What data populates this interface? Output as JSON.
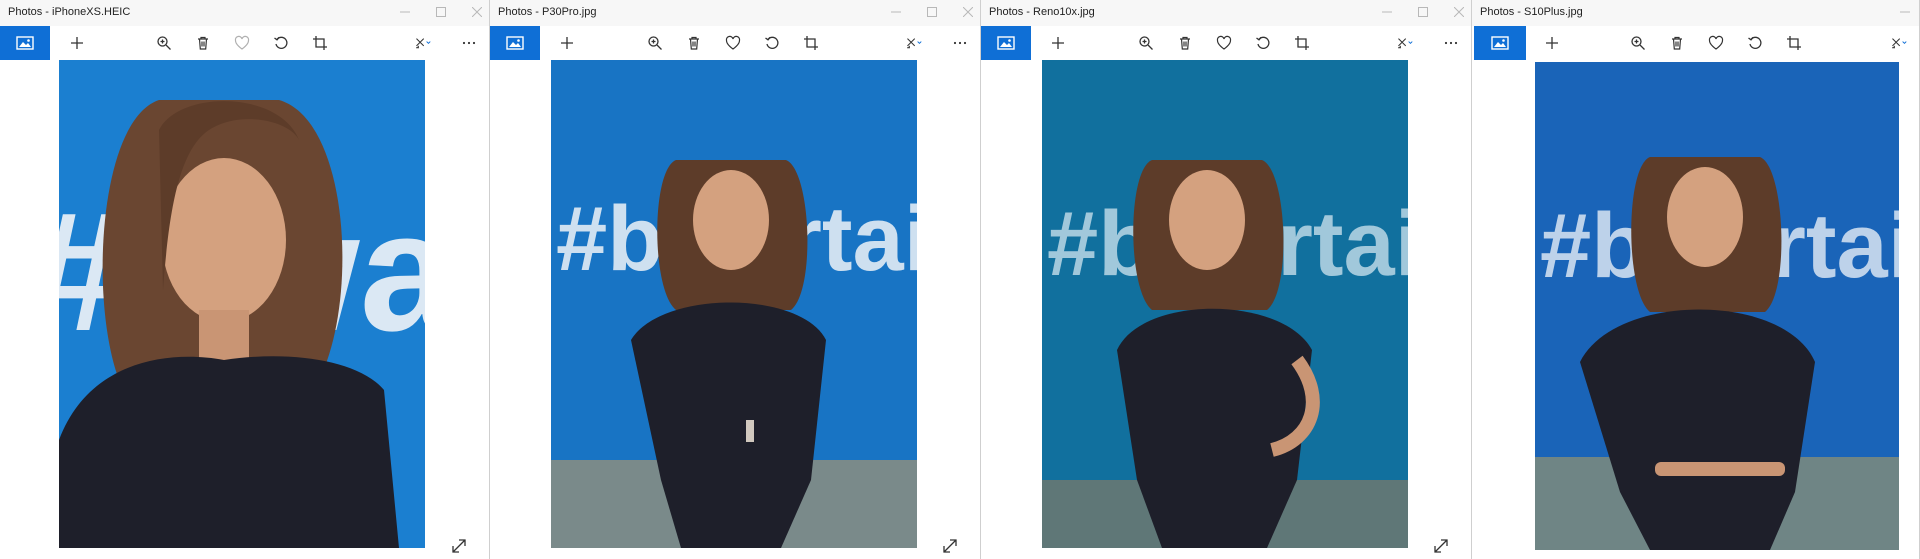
{
  "windows": [
    {
      "title": "Photos - iPhoneXS.HEIC",
      "photo_style": "closeup"
    },
    {
      "title": "Photos - P30Pro.jpg",
      "photo_style": "full"
    },
    {
      "title": "Photos - Reno10x.jpg",
      "photo_style": "full"
    },
    {
      "title": "Photos - S10Plus.jpg",
      "photo_style": "full"
    }
  ],
  "toolbar_icons": [
    "photos-home-icon",
    "add-icon",
    "zoom-icon",
    "delete-icon",
    "favorite-icon",
    "rotate-icon",
    "crop-icon",
    "edit-create-icon",
    "more-icon"
  ],
  "wall_text": "#bwartai",
  "colors": {
    "accent": "#0f6fd6",
    "wall_blue": "#1b7fd0",
    "dress": "#1e1f2a",
    "skin": "#d4a17f",
    "hair": "#6a4631"
  }
}
